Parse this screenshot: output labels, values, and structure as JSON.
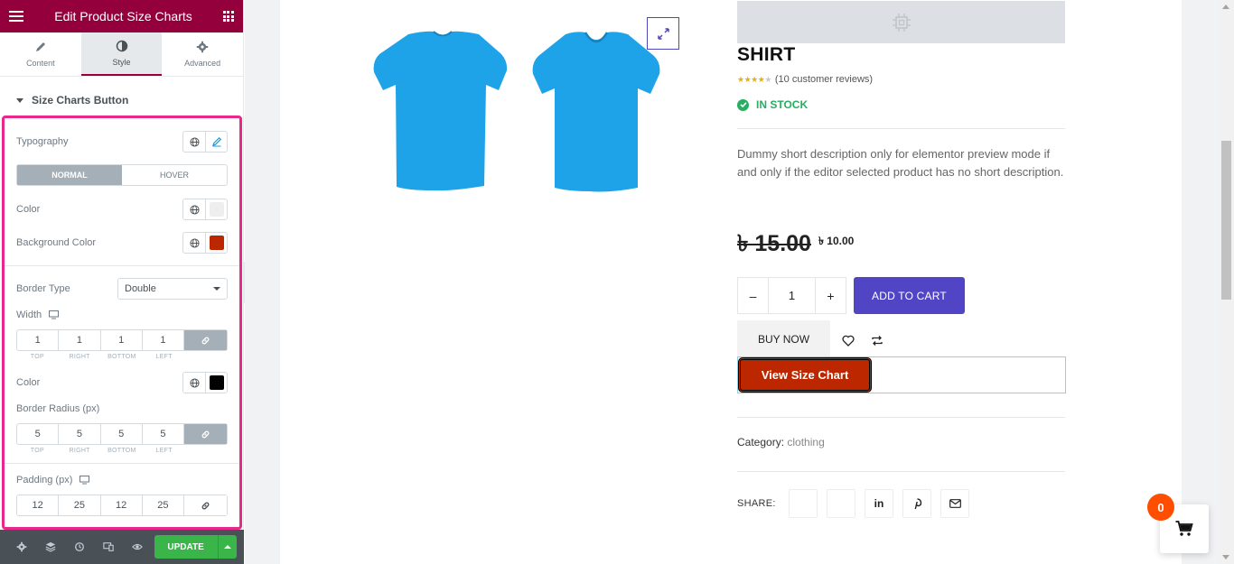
{
  "panel": {
    "title": "Edit Product Size Charts",
    "tabs": [
      {
        "label": "Content",
        "icon": "pencil-icon"
      },
      {
        "label": "Style",
        "icon": "half-circle-icon"
      },
      {
        "label": "Advanced",
        "icon": "gear-icon"
      }
    ],
    "active_tab": "Style",
    "section_title": "Size Charts Button",
    "typography_label": "Typography",
    "state_tabs": {
      "normal": "NORMAL",
      "hover": "HOVER"
    },
    "color_label": "Color",
    "color_value": "#eeeeee",
    "background_color_label": "Background Color",
    "background_color_value": "#bd2700",
    "border_type_label": "Border Type",
    "border_type_value": "Double",
    "width_label": "Width",
    "width_values": [
      "1",
      "1",
      "1",
      "1"
    ],
    "dim_labels": [
      "TOP",
      "RIGHT",
      "BOTTOM",
      "LEFT"
    ],
    "border_color_label": "Color",
    "border_color_value": "#000000",
    "border_radius_label": "Border Radius (px)",
    "border_radius_values": [
      "5",
      "5",
      "5",
      "5"
    ],
    "padding_label": "Padding (px)",
    "padding_values": [
      "12",
      "25",
      "12",
      "25"
    ],
    "update_label": "UPDATE"
  },
  "product": {
    "title": "SHIRT",
    "rating": 3.5,
    "reviews_text": "(10 customer reviews)",
    "stock": "IN STOCK",
    "description": "Dummy short description only for elementor preview mode if and only if the editor selected product has no short description.",
    "price_old": "৳ 15.00",
    "price_new": "৳ 10.00",
    "quantity": "1",
    "qty_minus": "–",
    "qty_plus": "+",
    "add_to_cart": "ADD TO CART",
    "buy_now": "BUY NOW",
    "size_chart_button": "View Size Chart",
    "category_label": "Category:",
    "category_value": "clothing",
    "share_label": "SHARE:",
    "share_linkedin": "in"
  },
  "cart": {
    "count": "0"
  },
  "colors": {
    "panel_header": "#93003c",
    "highlight_border": "#e8288a",
    "add_to_cart": "#5145c6",
    "size_chart_bg": "#bd2700",
    "update": "#39b54a",
    "cart_badge": "#ff4e00",
    "shirt": "#1fa3e8"
  }
}
